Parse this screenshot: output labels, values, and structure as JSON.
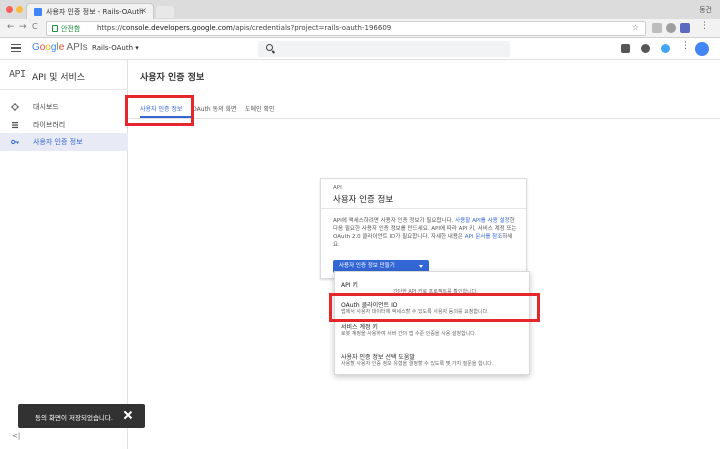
{
  "browser": {
    "tab_title": "사용자 인증 정보 - Rails-OAuth",
    "tab_close": "×",
    "user_label": "동건",
    "back": "←",
    "forward": "→",
    "reload": "C",
    "secure_label": "안전함",
    "url_scheme": "https://",
    "url_host": "console.developers.google.com",
    "url_path": "/apis/credentials?project=rails-oauth-196609",
    "star": "☆"
  },
  "header": {
    "logo_g": "G",
    "logo_o1": "o",
    "logo_o2": "o",
    "logo_g2": "g",
    "logo_l": "l",
    "logo_e": "e",
    "logo_apis": " APIs",
    "project": "Rails-OAuth ▾"
  },
  "sidebar": {
    "mark": "API",
    "title": "API 및 서비스",
    "items": [
      {
        "label": "대시보드"
      },
      {
        "label": "라이브러리"
      },
      {
        "label": "사용자 인증 정보"
      }
    ],
    "collapse": "<|"
  },
  "main": {
    "title": "사용자 인증 정보",
    "tabs": [
      {
        "label": "사용자 인증 정보"
      },
      {
        "label": "OAuth 동의 화면"
      },
      {
        "label": "도메인 확인"
      }
    ]
  },
  "card": {
    "kicker": "API",
    "title": "사용자 인증 정보",
    "body_1": "API에 액세스하려면 사용자 인증 정보가 필요합니다. ",
    "body_link_1": "사용할 API를 사용 설정",
    "body_2": "한 다음 필요한 사용자 인증 정보를 만드세요. API에 따라 API 키, 서비스 계정 또는 OAuth 2.0 클라이언트 ID가 필요합니다. 자세한 내용은 ",
    "body_link_2": "API 문서를 참조",
    "body_3": "하세요.",
    "button": "사용자 인증 정보 만들기"
  },
  "menu": {
    "items": [
      {
        "title": "API 키",
        "desc": "간단한 API 키로 프로젝트를 확인합니다."
      },
      {
        "title": "OAuth 클라이언트 ID",
        "desc": "앱에서 사용자 데이터에 액세스할 수 있도록 사용자 동의를 요청합니다."
      },
      {
        "title": "서비스 계정 키",
        "desc": "로봇 계정을 사용하여 서버 간의 앱 수준 인증을 사용 설정합니다."
      },
      {
        "title": "사용자 인증 정보 선택 도움말",
        "desc": "사용할 사용자 인증 정보 유형을 결정할 수 있도록 몇 가지 질문을 합니다."
      }
    ]
  },
  "snackbar": {
    "message": "동의 화면이 저장되었습니다."
  },
  "colors": {
    "accent": "#3367d6",
    "annotation": "#e5262a",
    "snackbar": "#323232"
  }
}
